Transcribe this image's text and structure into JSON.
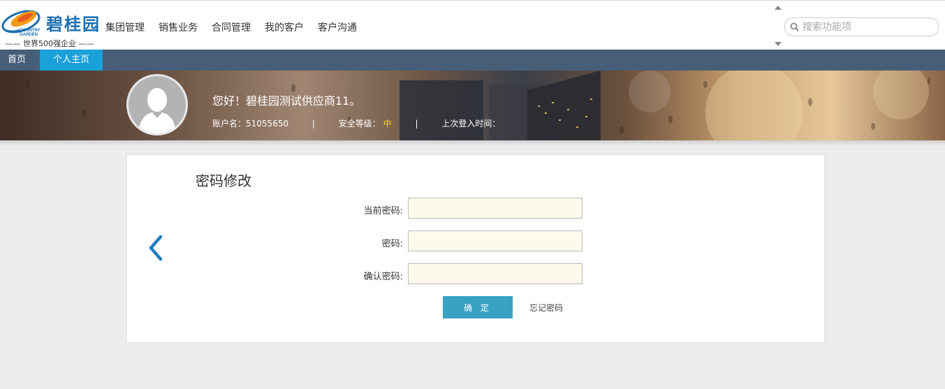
{
  "brand": {
    "name": "碧桂园",
    "english_top": "COUNTRY",
    "english_bottom": "GARDEN",
    "slogan": "—— 世界500强企业 ——"
  },
  "top_nav": [
    "集团管理",
    "销售业务",
    "合同管理",
    "我的客户",
    "客户沟通"
  ],
  "search": {
    "placeholder": "搜索功能项"
  },
  "sub_nav": {
    "home": "首页",
    "personal": "个人主页"
  },
  "profile": {
    "greeting": "您好！碧桂园测试供应商11。",
    "account_label": "账户名：",
    "account_value": "51055650",
    "separator": "|",
    "security_label": "安全等级：",
    "security_value": "中",
    "last_login_label": "上次登入时间："
  },
  "form": {
    "title": "密码修改",
    "current_password_label": "当前密码:",
    "password_label": "密码:",
    "confirm_password_label": "确认密码:",
    "submit_label": "确 定",
    "forgot_label": "忘记密码"
  },
  "colors": {
    "subnav_bg": "#475e78",
    "active_tab": "#1ba1d9",
    "primary_button": "#39a1c4",
    "security_level": "#f3d33a",
    "input_bg": "#fefaeb"
  }
}
